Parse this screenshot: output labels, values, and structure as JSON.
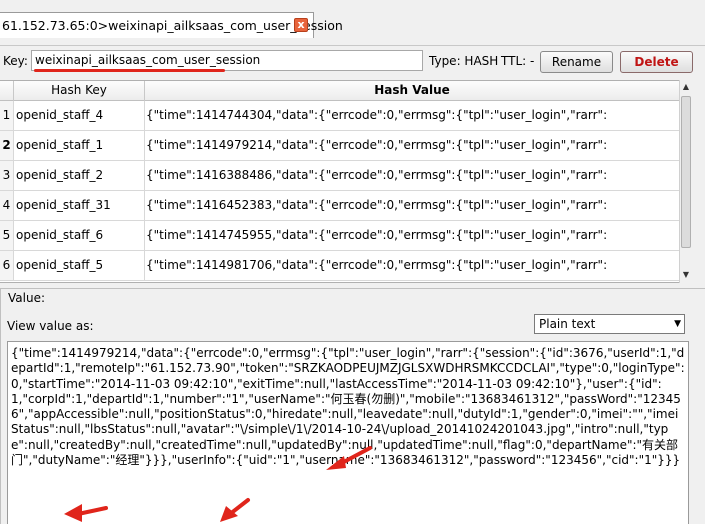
{
  "tab": {
    "title": "61.152.73.65:0>weixinapi_ailksaas_com_user_session",
    "close_icon": "close-icon",
    "close_glyph": "x"
  },
  "key_row": {
    "key_label": "Key:",
    "key_value": "weixinapi_ailksaas_com_user_session",
    "type_label": "Type: HASH",
    "ttl_label": "TTL: -",
    "rename_label": "Rename",
    "delete_label": "Delete"
  },
  "table": {
    "headers": {
      "key": "Hash Key",
      "value": "Hash Value"
    },
    "rows": [
      {
        "num": "1",
        "key": "openid_staff_4",
        "value": "{\"time\":1414744304,\"data\":{\"errcode\":0,\"errmsg\":{\"tpl\":\"user_login\",\"rarr\":"
      },
      {
        "num": "2",
        "key": "openid_staff_1",
        "value": "{\"time\":1414979214,\"data\":{\"errcode\":0,\"errmsg\":{\"tpl\":\"user_login\",\"rarr\":"
      },
      {
        "num": "3",
        "key": "openid_staff_2",
        "value": "{\"time\":1416388486,\"data\":{\"errcode\":0,\"errmsg\":{\"tpl\":\"user_login\",\"rarr\":"
      },
      {
        "num": "4",
        "key": "openid_staff_31",
        "value": "{\"time\":1416452383,\"data\":{\"errcode\":0,\"errmsg\":{\"tpl\":\"user_login\",\"rarr\":"
      },
      {
        "num": "5",
        "key": "openid_staff_6",
        "value": "{\"time\":1414745955,\"data\":{\"errcode\":0,\"errmsg\":{\"tpl\":\"user_login\",\"rarr\":"
      },
      {
        "num": "6",
        "key": "openid_staff_5",
        "value": "{\"time\":1414981706,\"data\":{\"errcode\":0,\"errmsg\":{\"tpl\":\"user_login\",\"rarr\":"
      }
    ],
    "selected_row": "2"
  },
  "value_panel": {
    "legend": "Value:",
    "view_as_label": "View value as:",
    "view_as_selected": "Plain text",
    "text": "{\"time\":1414979214,\"data\":{\"errcode\":0,\"errmsg\":{\"tpl\":\"user_login\",\"rarr\":{\"session\":{\"id\":3676,\"userId\":1,\"departId\":1,\"remoteIp\":\"61.152.73.90\",\"token\":\"SRZKAODPEUJMZJGLSXWDHRSMKCCDCLAI\",\"type\":0,\"loginType\":0,\"startTime\":\"2014-11-03 09:42:10\",\"exitTime\":null,\"lastAccessTime\":\"2014-11-03 09:42:10\"},\"user\":{\"id\":1,\"corpId\":1,\"departId\":1,\"number\":\"1\",\"userName\":\"何玉春(勿删)\",\"mobile\":\"13683461312\",\"passWord\":\"123456\",\"appAccessible\":null,\"positionStatus\":0,\"hiredate\":null,\"leavedate\":null,\"dutyId\":1,\"gender\":0,\"imei\":\"\",\"imeiStatus\":null,\"lbsStatus\":null,\"avatar\":\"\\/simple\\/1\\/2014-10-24\\/upload_20141024201043.jpg\",\"intro\":null,\"type\":null,\"createdBy\":null,\"createdTime\":null,\"updatedBy\":null,\"updatedTime\":null,\"flag\":0,\"departName\":\"有关部门\",\"dutyName\":\"经理\"}}},\"userInfo\":{\"uid\":\"1\",\"username\":\"13683461312\",\"password\":\"123456\",\"cid\":\"1\"}}}"
  },
  "colors": {
    "annotation_red": "#e0251b",
    "delete_text": "#c01414",
    "tab_close": "#e8643c"
  }
}
